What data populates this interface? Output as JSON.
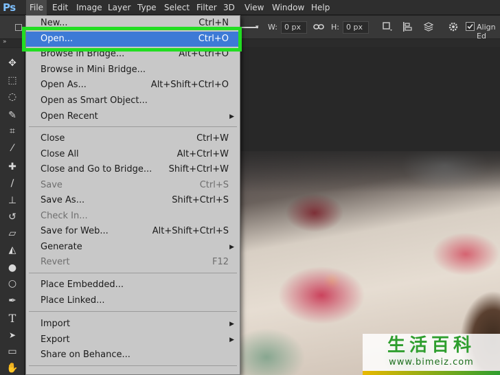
{
  "menubar": {
    "logo": "Ps",
    "items": [
      {
        "label": "File",
        "active": true
      },
      {
        "label": "Edit"
      },
      {
        "label": "Image"
      },
      {
        "label": "Layer"
      },
      {
        "label": "Type"
      },
      {
        "label": "Select"
      },
      {
        "label": "Filter"
      },
      {
        "label": "3D"
      },
      {
        "label": "View"
      },
      {
        "label": "Window"
      },
      {
        "label": "Help"
      }
    ]
  },
  "options_bar": {
    "w_label": "W:",
    "w_value": "0 px",
    "h_label": "H:",
    "h_value": "0 px",
    "align_label": "Align Ed",
    "align_checked": true,
    "icons": [
      "link-icon",
      "path-ops-icon",
      "path-align-icon",
      "path-arrange-icon",
      "gear-icon"
    ]
  },
  "toolbar": {
    "tools": [
      {
        "name": "move-tool-icon",
        "glyph": "✥"
      },
      {
        "name": "marquee-tool-icon",
        "glyph": "⬚"
      },
      {
        "name": "lasso-tool-icon",
        "glyph": "◌"
      },
      {
        "name": "quick-select-tool-icon",
        "glyph": "✎"
      },
      {
        "name": "crop-tool-icon",
        "glyph": "⌗"
      },
      {
        "name": "eyedropper-tool-icon",
        "glyph": "⁄"
      },
      {
        "name": "healing-brush-tool-icon",
        "glyph": "✚"
      },
      {
        "name": "brush-tool-icon",
        "glyph": "∕"
      },
      {
        "name": "clone-stamp-tool-icon",
        "glyph": "⊥"
      },
      {
        "name": "history-brush-tool-icon",
        "glyph": "↺"
      },
      {
        "name": "eraser-tool-icon",
        "glyph": "▱"
      },
      {
        "name": "paint-bucket-tool-icon",
        "glyph": "◭"
      },
      {
        "name": "blur-tool-icon",
        "glyph": "●"
      },
      {
        "name": "dodge-tool-icon",
        "glyph": "○"
      },
      {
        "name": "pen-tool-icon",
        "glyph": "✒"
      },
      {
        "name": "type-tool-icon",
        "glyph": "T"
      },
      {
        "name": "path-select-tool-icon",
        "glyph": "➤"
      },
      {
        "name": "rectangle-tool-icon",
        "glyph": "▭"
      },
      {
        "name": "hand-tool-icon",
        "glyph": "✋"
      }
    ]
  },
  "file_menu": {
    "items": [
      {
        "label": "New...",
        "shortcut": "Ctrl+N"
      },
      {
        "label": "Open...",
        "shortcut": "Ctrl+O",
        "highlight": true
      },
      {
        "label": "Browse in Bridge...",
        "shortcut": "Alt+Ctrl+O"
      },
      {
        "label": "Browse in Mini Bridge...",
        "shortcut": ""
      },
      {
        "label": "Open As...",
        "shortcut": "Alt+Shift+Ctrl+O"
      },
      {
        "label": "Open as Smart Object...",
        "shortcut": ""
      },
      {
        "label": "Open Recent",
        "shortcut": "",
        "submenu": true
      },
      {
        "label": "Close",
        "shortcut": "Ctrl+W"
      },
      {
        "label": "Close All",
        "shortcut": "Alt+Ctrl+W"
      },
      {
        "label": "Close and Go to Bridge...",
        "shortcut": "Shift+Ctrl+W"
      },
      {
        "label": "Save",
        "shortcut": "Ctrl+S",
        "disabled": true
      },
      {
        "label": "Save As...",
        "shortcut": "Shift+Ctrl+S"
      },
      {
        "label": "Check In...",
        "shortcut": "",
        "disabled": true
      },
      {
        "label": "Save for Web...",
        "shortcut": "Alt+Shift+Ctrl+S"
      },
      {
        "label": "Generate",
        "shortcut": "",
        "submenu": true
      },
      {
        "label": "Revert",
        "shortcut": "F12",
        "disabled": true
      },
      {
        "label": "Place Embedded...",
        "shortcut": ""
      },
      {
        "label": "Place Linked...",
        "shortcut": ""
      },
      {
        "label": "Import",
        "shortcut": "",
        "submenu": true
      },
      {
        "label": "Export",
        "shortcut": "",
        "submenu": true
      },
      {
        "label": "Share on Behance...",
        "shortcut": ""
      }
    ]
  },
  "watermark": {
    "title": "生活百科",
    "url": "www.bimeiz.com"
  },
  "colors": {
    "highlight": "#3d7ad6",
    "callout": "#22dd22",
    "menu_bg": "#c8c8c8"
  }
}
